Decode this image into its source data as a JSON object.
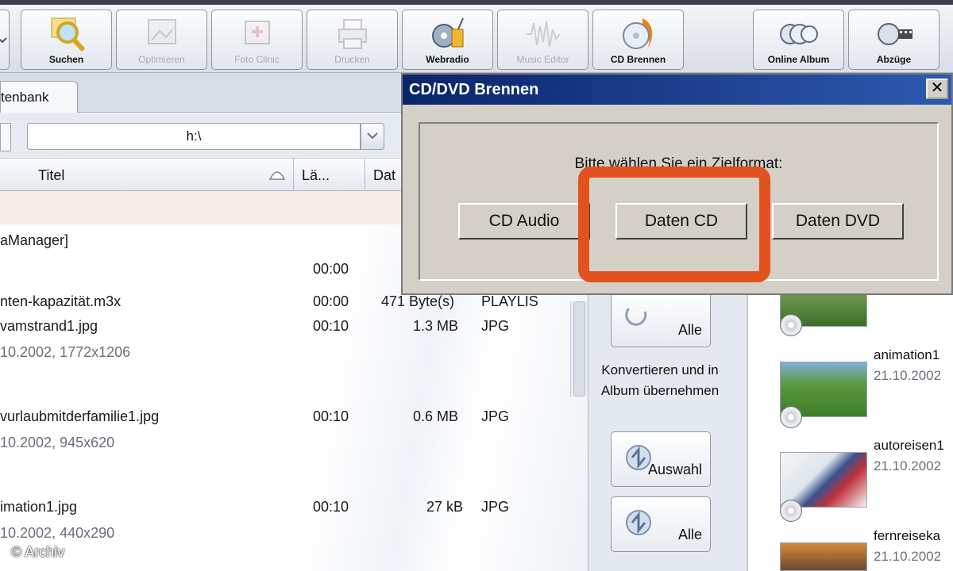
{
  "toolbar": {
    "buttons": [
      {
        "label": "Suchen",
        "icon": "magnifier-icon",
        "enabled": true
      },
      {
        "label": "Optimieren",
        "icon": "picture-frame-icon",
        "enabled": false
      },
      {
        "label": "Foto Clinic",
        "icon": "photo-clinic-icon",
        "enabled": false
      },
      {
        "label": "Drucken",
        "icon": "printer-icon",
        "enabled": false
      },
      {
        "label": "Webradio",
        "icon": "radio-icon",
        "enabled": true
      },
      {
        "label": "Music Editor",
        "icon": "waveform-icon",
        "enabled": false
      },
      {
        "label": "CD Brennen",
        "icon": "burning-cd-icon",
        "enabled": true
      },
      {
        "label": "Online Album",
        "icon": "cd-stack-icon",
        "enabled": true
      },
      {
        "label": "Abzüge",
        "icon": "film-reel-icon",
        "enabled": true
      }
    ]
  },
  "tab": {
    "label": "tenbank"
  },
  "path": {
    "value": "h:\\"
  },
  "columns": {
    "titel": "Titel",
    "laenge": "Lä...",
    "datum": "Dat"
  },
  "files": [
    {
      "name": "aManager]",
      "time": "",
      "size": "",
      "type": "",
      "meta": ""
    },
    {
      "name": "",
      "time": "00:00",
      "size": "",
      "type": "",
      "meta": ""
    },
    {
      "name": "nten-kapazität.m3x",
      "time": "00:00",
      "size": "471 Byte(s)",
      "type": "PLAYLIS",
      "meta": ""
    },
    {
      "name": "vamstrand1.jpg",
      "time": "00:10",
      "size": "1.3 MB",
      "type": "JPG",
      "meta": "10.2002,  1772x1206"
    },
    {
      "name": "vurlaubmitderfamilie1.jpg",
      "time": "00:10",
      "size": "0.6 MB",
      "type": "JPG",
      "meta": "10.2002,  945x620"
    },
    {
      "name": "imation1.jpg",
      "time": "00:10",
      "size": "27 kB",
      "type": "JPG",
      "meta": "10.2002,  440x290"
    }
  ],
  "side": {
    "alle_top": "Alle",
    "konvertieren": "Konvertieren und in Album übernehmen",
    "auswahl": "Auswahl",
    "alle_bottom": "Alle"
  },
  "album": [
    {
      "name": "",
      "date": ""
    },
    {
      "name": "animation1",
      "date": "21.10.2002"
    },
    {
      "name": "autoreisen1",
      "date": "21.10.2002"
    },
    {
      "name": "fernreiseka",
      "date": "21.10.2002"
    }
  ],
  "dialog": {
    "title": "CD/DVD Brennen",
    "close": "✕",
    "prompt": "Bitte wählen Sie ein Zielformat:",
    "buttons": {
      "cd_audio": "CD Audio",
      "daten_cd": "Daten CD",
      "daten_dvd": "Daten DVD"
    }
  },
  "colors": {
    "highlight": "#e2521f",
    "title_bar": "#0a246a",
    "dialog_bg": "#d4d0c8"
  },
  "watermark": "© Archiv"
}
